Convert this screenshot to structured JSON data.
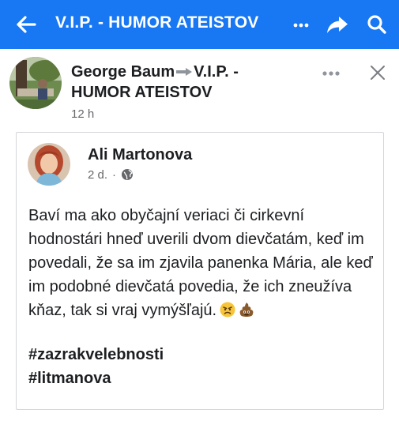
{
  "header": {
    "title": "V.I.P. - HUMOR  ATEISTOV",
    "back_icon": "arrow-left-icon",
    "more_icon": "ellipsis-icon",
    "share_icon": "share-arrow-icon",
    "search_icon": "search-icon",
    "bar_color": "#1877f2"
  },
  "post": {
    "author": "George Baum",
    "group_line1": "V.I.P. -",
    "group_line2": "HUMOR  ATEISTOV",
    "time": "12 h"
  },
  "shared": {
    "author": "Ali Martonova",
    "time": "2 d.",
    "separator": "·",
    "text": "Baví ma ako obyčajní veriaci či cirkevní hodnostári hneď uverili dvom dievčatám, keď im povedali, že sa im zjavila panenka Mária, ale keď im podobné dievčatá povedia, že ich zneužíva kňaz, tak si vraj vymýšľajú.",
    "emojis": [
      "angry-face-emoji",
      "pile-of-poo-emoji"
    ],
    "hashtag1": "#zazrakvelebnosti",
    "hashtag2": "#litmanova"
  }
}
